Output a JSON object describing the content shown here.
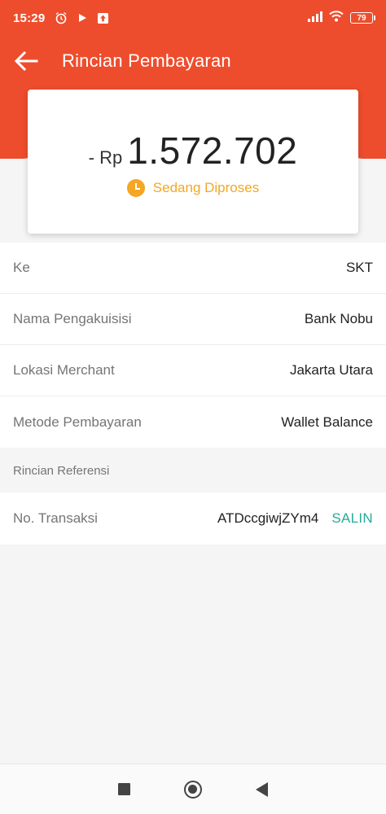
{
  "status_bar": {
    "time": "15:29",
    "battery": "79",
    "icons": [
      "alarm-icon",
      "play-icon",
      "upload-icon",
      "signal-icon",
      "wifi-icon",
      "battery-icon"
    ]
  },
  "header": {
    "title": "Rincian Pembayaran",
    "back_icon": "arrow-left-icon",
    "color": "#ee4d2d"
  },
  "amount": {
    "prefix": "- Rp",
    "value": "1.572.702",
    "status": "Sedang Diproses",
    "status_color": "#f5a623",
    "status_icon": "clock-icon"
  },
  "details": [
    {
      "label": "Ke",
      "value": "SKT"
    },
    {
      "label": "Nama Pengakuisisi",
      "value": "Bank Nobu"
    },
    {
      "label": "Lokasi Merchant",
      "value": "Jakarta Utara"
    },
    {
      "label": "Metode Pembayaran",
      "value": "Wallet Balance"
    }
  ],
  "reference": {
    "section_title": "Rincian Referensi",
    "label": "No. Transaksi",
    "value": "ATDccgiwjZYm4",
    "copy_label": "SALIN",
    "copy_color": "#26aa99"
  },
  "navbar": {
    "icons": [
      "recent-apps-icon",
      "home-icon",
      "back-icon"
    ]
  }
}
